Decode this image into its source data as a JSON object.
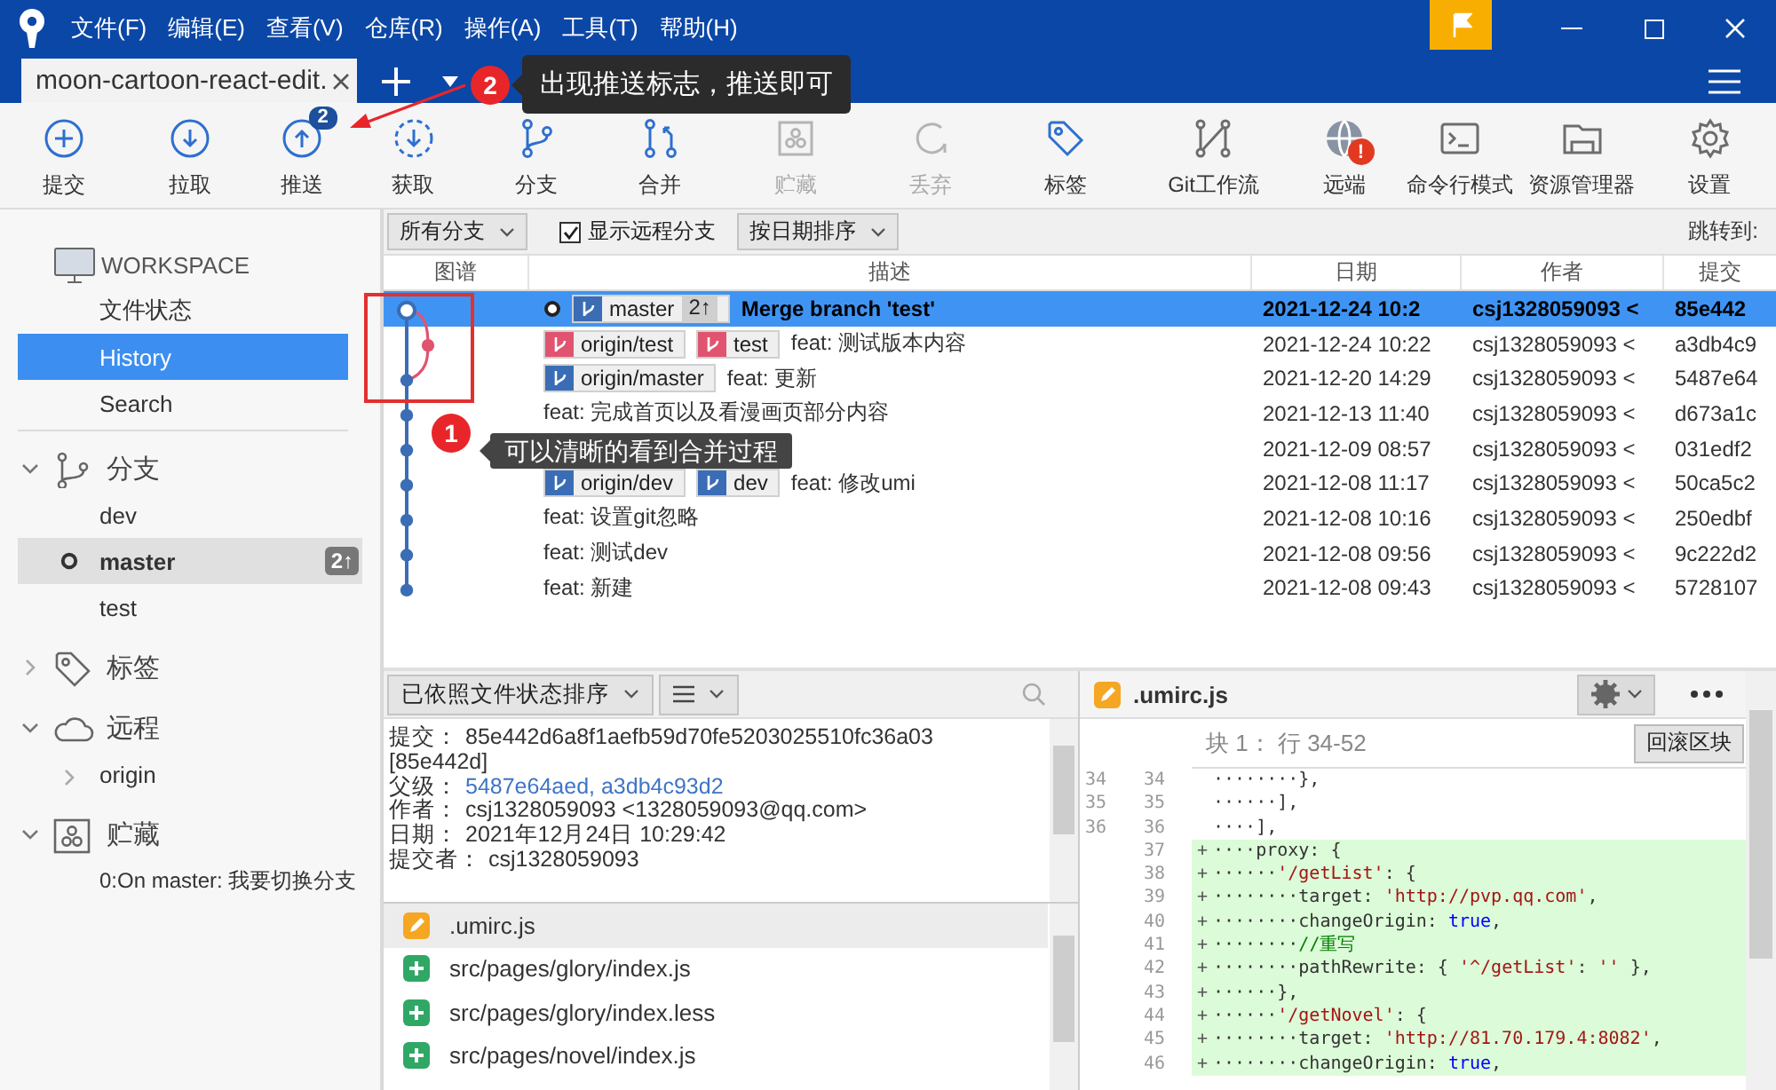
{
  "window": {
    "menu": [
      "文件(F)",
      "编辑(E)",
      "查看(V)",
      "仓库(R)",
      "操作(A)",
      "工具(T)",
      "帮助(H)"
    ]
  },
  "tabs": [
    {
      "label": "moon-cartoon-react-edit.",
      "selected": true
    }
  ],
  "callouts": [
    {
      "number": "2",
      "text": "出现推送标志，推送即可"
    },
    {
      "number": "1",
      "text": "可以清晰的看到合并过程"
    }
  ],
  "toolbar": [
    {
      "kind": "commit",
      "label": "提交",
      "disabled": false
    },
    {
      "kind": "pull",
      "label": "拉取",
      "disabled": false
    },
    {
      "kind": "push",
      "label": "推送",
      "disabled": false,
      "badge": "2"
    },
    {
      "kind": "fetch",
      "label": "获取",
      "disabled": false
    },
    {
      "kind": "branch",
      "label": "分支",
      "disabled": false
    },
    {
      "kind": "merge",
      "label": "合并",
      "disabled": false
    },
    {
      "kind": "stash",
      "label": "贮藏",
      "disabled": true
    },
    {
      "kind": "discard",
      "label": "丢弃",
      "disabled": true
    },
    {
      "kind": "tag",
      "label": "标签",
      "disabled": false
    },
    {
      "kind": "flow",
      "label": "Git工作流",
      "disabled": false
    },
    {
      "kind": "remote",
      "label": "远端",
      "disabled": false,
      "alert": "!"
    },
    {
      "kind": "terminal",
      "label": "命令行模式",
      "disabled": false
    },
    {
      "kind": "explorer",
      "label": "资源管理器",
      "disabled": false
    },
    {
      "kind": "settings",
      "label": "设置",
      "disabled": false
    }
  ],
  "sidebar": {
    "sections": [
      {
        "kind": "workspace",
        "title": "WORKSPACE",
        "items": [
          {
            "label": "文件状态",
            "selected": false
          },
          {
            "label": "History",
            "selected": true
          },
          {
            "label": "Search",
            "selected": false
          }
        ]
      },
      {
        "kind": "branches",
        "title": "分支",
        "expanded": true,
        "items": [
          {
            "label": "dev",
            "current": false
          },
          {
            "label": "master",
            "current": true,
            "badge": "2↑"
          },
          {
            "label": "test",
            "current": false
          }
        ]
      },
      {
        "kind": "tags",
        "title": "标签",
        "expanded": false
      },
      {
        "kind": "remotes",
        "title": "远程",
        "expanded": true,
        "items": [
          {
            "label": "origin",
            "expanded": false
          }
        ]
      },
      {
        "kind": "stashes",
        "title": "贮藏",
        "expanded": true,
        "items": [
          {
            "label": "0:On master: 我要切换分支"
          }
        ]
      }
    ]
  },
  "filter_bar": {
    "branch_filter": "所有分支",
    "show_remote": {
      "label": "显示远程分支",
      "checked": true
    },
    "sort": "按日期排序",
    "jump_label": "跳转到:"
  },
  "history": {
    "columns": [
      "图谱",
      "描述",
      "日期",
      "作者",
      "提交"
    ],
    "rows": [
      {
        "selected": true,
        "head": true,
        "color": "#3a6db5",
        "refs": [
          {
            "name": "master",
            "color": "#3a6db5",
            "badge": "2↑"
          }
        ],
        "description": "Merge branch 'test'",
        "date": "2021-12-24 10:2",
        "author": "csj1328059093 <",
        "commit": "85e442"
      },
      {
        "selected": false,
        "head": false,
        "color": "#e05470",
        "refs": [
          {
            "name": "origin/test",
            "color": "#e05470"
          },
          {
            "name": "test",
            "color": "#e05470"
          }
        ],
        "description": "feat: 测试版本内容",
        "date": "2021-12-24 10:22",
        "author": "csj1328059093 <",
        "commit": "a3db4c9"
      },
      {
        "selected": false,
        "head": false,
        "color": "#3a6db5",
        "refs": [
          {
            "name": "origin/master",
            "color": "#3a6db5"
          }
        ],
        "description": "feat: 更新",
        "date": "2021-12-20 14:29",
        "author": "csj1328059093 <",
        "commit": "5487e64"
      },
      {
        "selected": false,
        "head": false,
        "color": "#3a6db5",
        "description": "feat: 完成首页以及看漫画页部分内容",
        "date": "2021-12-13 11:40",
        "author": "csj1328059093 <",
        "commit": "d673a1c"
      },
      {
        "selected": false,
        "head": false,
        "color": "#3a6db5",
        "date": "2021-12-09 08:57",
        "author": "csj1328059093 <",
        "commit": "031edf2"
      },
      {
        "selected": false,
        "head": false,
        "color": "#3a6db5",
        "refs": [
          {
            "name": "origin/dev",
            "color": "#3a6db5"
          },
          {
            "name": "dev",
            "color": "#3a6db5"
          }
        ],
        "description": "feat: 修改umi",
        "date": "2021-12-08 11:17",
        "author": "csj1328059093 <",
        "commit": "50ca5c2"
      },
      {
        "selected": false,
        "head": false,
        "color": "#3a6db5",
        "description": "feat: 设置git忽略",
        "date": "2021-12-08 10:16",
        "author": "csj1328059093 <",
        "commit": "250edbf"
      },
      {
        "selected": false,
        "head": false,
        "color": "#3a6db5",
        "description": "feat: 测试dev",
        "date": "2021-12-08 09:56",
        "author": "csj1328059093 <",
        "commit": "9c222d2"
      },
      {
        "selected": false,
        "head": false,
        "color": "#3a6db5",
        "description": "feat: 新建",
        "date": "2021-12-08 09:43",
        "author": "csj1328059093 <",
        "commit": "5728107"
      }
    ]
  },
  "details": {
    "sort": "已依照文件状态排序",
    "lines": [
      {
        "label": "提交：",
        "value": "85e442d6a8f1aefb59d70fe5203025510fc36a03",
        "kind": "text"
      },
      {
        "value": "[85e442d]",
        "kind": "text"
      },
      {
        "label": "父级：",
        "value": "5487e64aed, a3db4c93d2",
        "kind": "link"
      },
      {
        "label": "作者：",
        "value": "csj1328059093 <1328059093@qq.com>",
        "kind": "text"
      },
      {
        "label": "日期：",
        "value": "2021年12月24日 10:29:42",
        "kind": "text"
      },
      {
        "label": "提交者：",
        "value": "csj1328059093",
        "kind": "text"
      }
    ],
    "files": [
      {
        "path": ".umirc.js",
        "kind": "modified",
        "selected": true
      },
      {
        "path": "src/pages/glory/index.js",
        "kind": "added",
        "selected": false
      },
      {
        "path": "src/pages/glory/index.less",
        "kind": "added",
        "selected": false
      },
      {
        "path": "src/pages/novel/index.js",
        "kind": "added",
        "selected": false
      }
    ]
  },
  "diff": {
    "file": ".umirc.js",
    "kind": "modified",
    "hunk": {
      "title": "块 1： 行 34-52",
      "button": "回滚区块"
    },
    "lines": [
      {
        "old": "34",
        "new": "34",
        "kind": "context",
        "segments": [
          {
            "kind": "plain",
            "text": "········},"
          }
        ]
      },
      {
        "old": "35",
        "new": "35",
        "kind": "context",
        "segments": [
          {
            "kind": "plain",
            "text": "······],"
          }
        ]
      },
      {
        "old": "36",
        "new": "36",
        "kind": "context",
        "segments": [
          {
            "kind": "plain",
            "text": "····],"
          }
        ]
      },
      {
        "new": "37",
        "kind": "added",
        "prefix": "+",
        "segments": [
          {
            "kind": "plain",
            "text": "····proxy: {"
          }
        ]
      },
      {
        "new": "38",
        "kind": "added",
        "prefix": "+",
        "segments": [
          {
            "kind": "plain",
            "text": "······"
          },
          {
            "kind": "string",
            "text": "'/getList'"
          },
          {
            "kind": "plain",
            "text": ": {"
          }
        ]
      },
      {
        "new": "39",
        "kind": "added",
        "prefix": "+",
        "segments": [
          {
            "kind": "plain",
            "text": "········target: "
          },
          {
            "kind": "string",
            "text": "'http://pvp.qq.com'"
          },
          {
            "kind": "plain",
            "text": ","
          }
        ]
      },
      {
        "new": "40",
        "kind": "added",
        "prefix": "+",
        "segments": [
          {
            "kind": "plain",
            "text": "········changeOrigin: "
          },
          {
            "kind": "keyword",
            "text": "true"
          },
          {
            "kind": "plain",
            "text": ","
          }
        ]
      },
      {
        "new": "41",
        "kind": "added",
        "prefix": "+",
        "segments": [
          {
            "kind": "plain",
            "text": "········"
          },
          {
            "kind": "comment",
            "text": "//重写"
          }
        ]
      },
      {
        "new": "42",
        "kind": "added",
        "prefix": "+",
        "segments": [
          {
            "kind": "plain",
            "text": "········pathRewrite: { "
          },
          {
            "kind": "string",
            "text": "'^/getList'"
          },
          {
            "kind": "plain",
            "text": ": "
          },
          {
            "kind": "string",
            "text": "''"
          },
          {
            "kind": "plain",
            "text": " },"
          }
        ]
      },
      {
        "new": "43",
        "kind": "added",
        "prefix": "+",
        "segments": [
          {
            "kind": "plain",
            "text": "······},"
          }
        ]
      },
      {
        "new": "44",
        "kind": "added",
        "prefix": "+",
        "segments": [
          {
            "kind": "plain",
            "text": "······"
          },
          {
            "kind": "string",
            "text": "'/getNovel'"
          },
          {
            "kind": "plain",
            "text": ": {"
          }
        ]
      },
      {
        "new": "45",
        "kind": "added",
        "prefix": "+",
        "segments": [
          {
            "kind": "plain",
            "text": "········target: "
          },
          {
            "kind": "string",
            "text": "'http://81.70.179.4:8082'"
          },
          {
            "kind": "plain",
            "text": ","
          }
        ]
      },
      {
        "new": "46",
        "kind": "added",
        "prefix": "+",
        "segments": [
          {
            "kind": "plain",
            "text": "········changeOrigin: "
          },
          {
            "kind": "keyword",
            "text": "true"
          },
          {
            "kind": "plain",
            "text": ","
          }
        ]
      }
    ]
  }
}
